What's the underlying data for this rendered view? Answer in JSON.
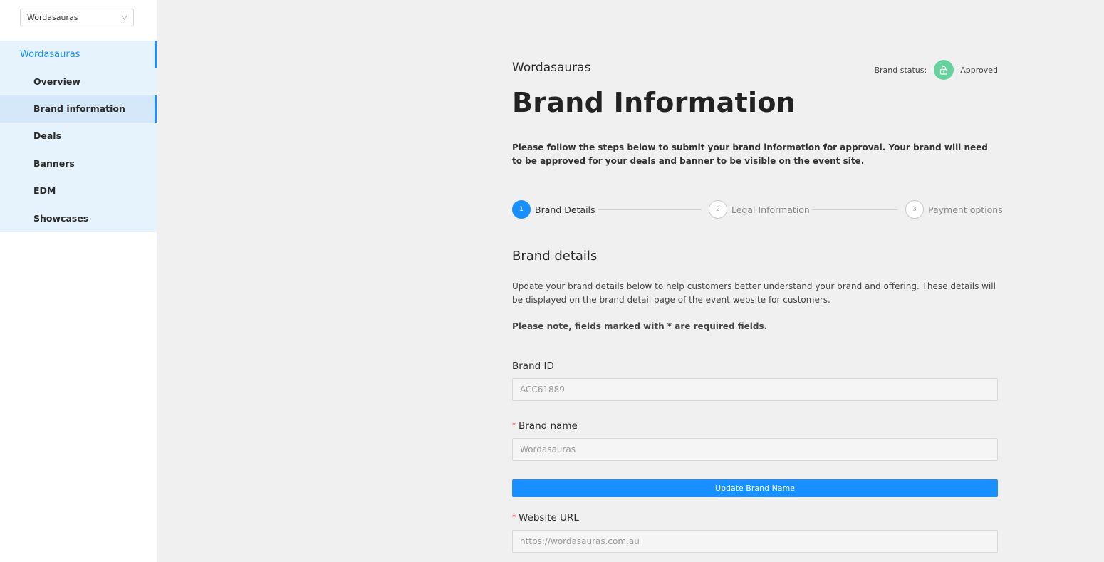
{
  "sidebar": {
    "select_value": "Wordasauras",
    "group_label": "Wordasauras",
    "items": [
      {
        "label": "Overview"
      },
      {
        "label": "Brand information"
      },
      {
        "label": "Deals"
      },
      {
        "label": "Banners"
      },
      {
        "label": "EDM"
      },
      {
        "label": "Showcases"
      }
    ],
    "active_item": "Brand information"
  },
  "header": {
    "brand_name": "Wordasauras",
    "status_label": "Brand status:",
    "status_value": "Approved",
    "status_icon": "lock-icon"
  },
  "page": {
    "title": "Brand Information",
    "intro": "Please follow the steps below to submit your brand information for approval. Your brand will need to be approved for your deals and banner to be visible on the event site."
  },
  "steps": [
    {
      "number": "1",
      "label": "Brand Details",
      "active": true
    },
    {
      "number": "2",
      "label": "Legal Information",
      "active": false
    },
    {
      "number": "3",
      "label": "Payment options",
      "active": false
    }
  ],
  "section": {
    "title": "Brand details",
    "description": "Update your brand details below to help customers better understand your brand and offering. These details will be displayed on the brand detail page of the event website for customers.",
    "required_note": "Please note, fields marked with * are required fields."
  },
  "form": {
    "brand_id": {
      "label": "Brand ID",
      "value": "ACC61889"
    },
    "brand_name": {
      "label": "Brand name",
      "value": "Wordasauras",
      "required": true
    },
    "update_button": "Update Brand Name",
    "website_url": {
      "label": "Website URL",
      "value": "https://wordasauras.com.au",
      "required": true
    }
  },
  "colors": {
    "accent": "#1890ff",
    "status_green": "#67d29d",
    "sidebar_bg": "#e6f3fd"
  }
}
